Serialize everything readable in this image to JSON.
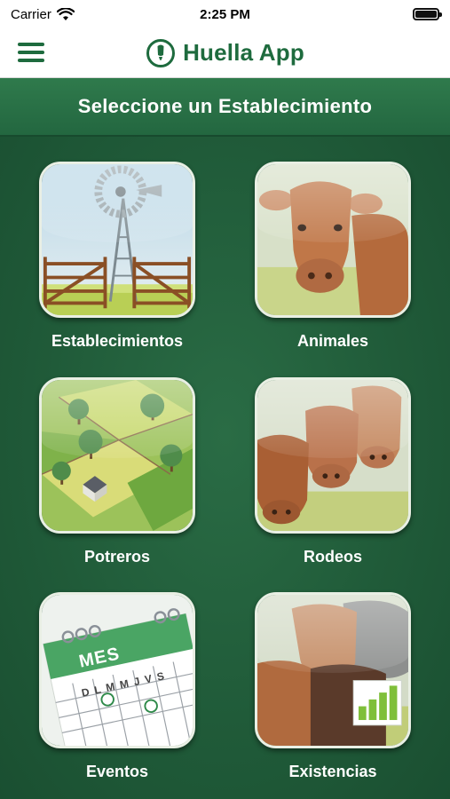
{
  "status_bar": {
    "carrier": "Carrier",
    "time": "2:25 PM",
    "wifi_icon": "wifi-icon",
    "battery_icon": "battery-icon"
  },
  "nav_bar": {
    "menu_icon": "hamburger-menu-icon",
    "logo_icon": "huella-footprint-logo-icon",
    "title": "Huella App",
    "brand_color": "#1e6b3e"
  },
  "header": {
    "title": "Seleccione un Establecimiento"
  },
  "tiles": [
    {
      "label": "Establecimientos",
      "image": "windmill-gate-illustration"
    },
    {
      "label": "Animales",
      "image": "cow-head-illustration"
    },
    {
      "label": "Potreros",
      "image": "fenced-pastures-illustration"
    },
    {
      "label": "Rodeos",
      "image": "herd-of-cows-illustration"
    },
    {
      "label": "Eventos",
      "image": "calendar-illustration",
      "calendar_title": "MES",
      "calendar_days": [
        "D",
        "L",
        "M",
        "M",
        "J",
        "V",
        "S"
      ]
    },
    {
      "label": "Existencias",
      "image": "cattle-stock-chart-illustration"
    }
  ],
  "colors": {
    "background": "#1f5a38",
    "header": "#2a7046",
    "label_text": "#ffffff"
  }
}
